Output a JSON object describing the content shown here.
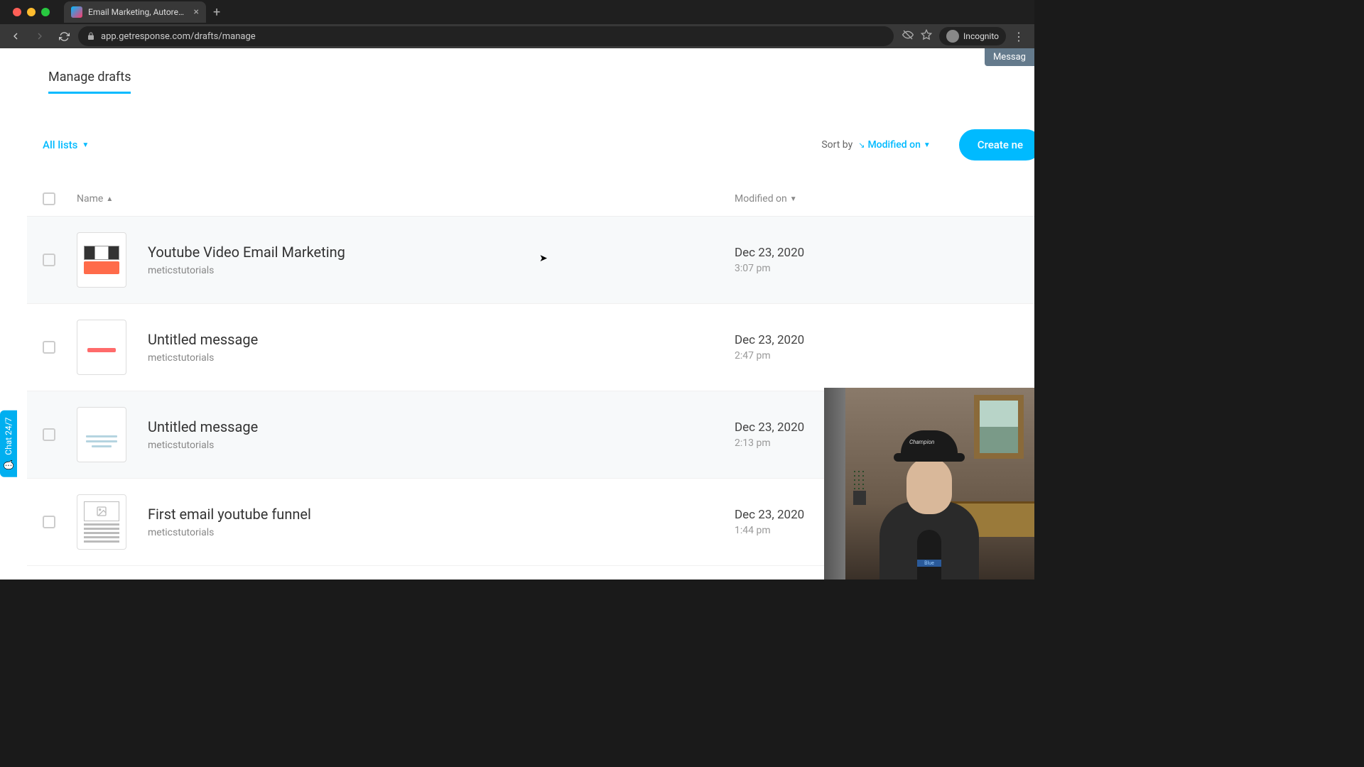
{
  "browser": {
    "tab_title": "Email Marketing, Autorespond",
    "url": "app.getresponse.com/drafts/manage",
    "incognito_label": "Incognito"
  },
  "notification": {
    "text": "Messag"
  },
  "page_tab": "Manage drafts",
  "filter": {
    "label": "All lists"
  },
  "sort": {
    "label": "Sort by",
    "value": "Modified on"
  },
  "create_button": "Create ne",
  "columns": {
    "name": "Name",
    "modified": "Modified on"
  },
  "rows": [
    {
      "name": "Youtube Video Email Marketing",
      "list": "meticstutorials",
      "date": "Dec 23, 2020",
      "time": "3:07 pm",
      "thumb_type": "video"
    },
    {
      "name": "Untitled message",
      "list": "meticstutorials",
      "date": "Dec 23, 2020",
      "time": "2:47 pm",
      "thumb_type": "simple"
    },
    {
      "name": "Untitled message",
      "list": "meticstutorials",
      "date": "Dec 23, 2020",
      "time": "2:13 pm",
      "thumb_type": "textlines"
    },
    {
      "name": "First email youtube funnel",
      "list": "meticstutorials",
      "date": "Dec 23, 2020",
      "time": "1:44 pm",
      "thumb_type": "draft"
    }
  ],
  "chat": {
    "label": "Chat 24/7"
  }
}
